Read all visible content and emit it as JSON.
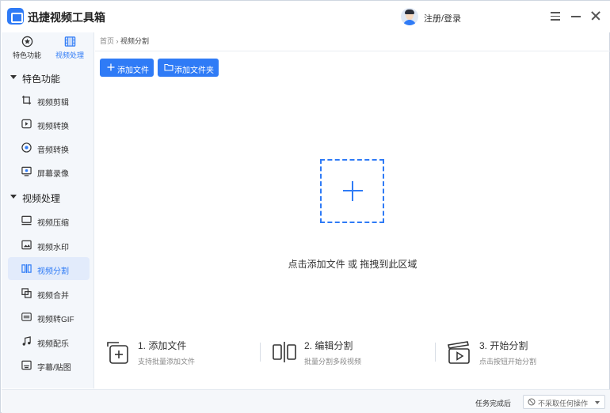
{
  "app": {
    "title": "迅捷视频工具箱",
    "login_label": "注册/登录",
    "accent_color": "#2f7bf6"
  },
  "window_controls": {
    "icons": [
      "menu-icon",
      "minimize-icon",
      "close-icon"
    ]
  },
  "sidebar": {
    "top_tabs": [
      {
        "label": "特色功能",
        "icon": "star-icon",
        "active": false
      },
      {
        "label": "视频处理",
        "icon": "film-icon",
        "active": true
      }
    ],
    "sections": [
      {
        "title": "特色功能",
        "items": [
          {
            "label": "视频剪辑",
            "icon": "crop-icon"
          },
          {
            "label": "视频转换",
            "icon": "video-convert-icon"
          },
          {
            "label": "音频转换",
            "icon": "audio-convert-icon"
          },
          {
            "label": "屏幕录像",
            "icon": "screen-record-icon"
          }
        ]
      },
      {
        "title": "视频处理",
        "items": [
          {
            "label": "视频压缩",
            "icon": "monitor-compress-icon"
          },
          {
            "label": "视频水印",
            "icon": "watermark-icon"
          },
          {
            "label": "视频分割",
            "icon": "split-icon",
            "active": true
          },
          {
            "label": "视频合并",
            "icon": "merge-icon"
          },
          {
            "label": "视频转GIF",
            "icon": "gif-icon"
          },
          {
            "label": "视频配乐",
            "icon": "music-icon"
          },
          {
            "label": "字幕/贴图",
            "icon": "subtitle-icon"
          }
        ]
      }
    ]
  },
  "breadcrumb": {
    "home": "首页",
    "separator": "›",
    "current": "视频分割"
  },
  "toolbar": {
    "add_file": "添加文件",
    "add_folder": "添加文件夹"
  },
  "dropzone": {
    "hint": "点击添加文件 或 拖拽到此区域"
  },
  "steps": [
    {
      "title": "1. 添加文件",
      "desc": "支持批量添加文件",
      "icon": "add-file-icon"
    },
    {
      "title": "2. 编辑分割",
      "desc": "批量分割多段视频",
      "icon": "split-edit-icon"
    },
    {
      "title": "3. 开始分割",
      "desc": "点击按钮开始分割",
      "icon": "clapper-icon"
    }
  ],
  "status": {
    "label": "任务完成后",
    "select_value": "不采取任何操作"
  }
}
